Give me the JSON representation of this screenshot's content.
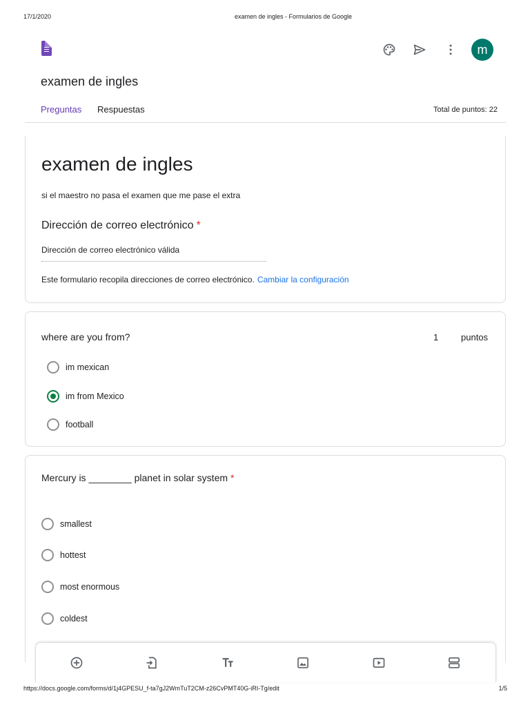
{
  "print": {
    "date": "17/1/2020",
    "title": "examen de ingles - Formularios de Google",
    "url": "https://docs.google.com/forms/d/1j4GPESU_f-ta7gJ2WmTuT2CM-z26CvPMT40G-iRI-Tg/edit",
    "page": "1/5"
  },
  "header": {
    "form_name": "examen de ingles",
    "avatar_letter": "m",
    "icons": [
      "forms-logo-icon",
      "palette-icon",
      "send-icon",
      "more-vert-icon"
    ],
    "colors": {
      "accent": "#673ab7",
      "avatar": "#00796b",
      "link": "#1a73e8",
      "required": "#d93025",
      "radio_checked": "#0b8043"
    }
  },
  "tabs": {
    "questions": "Preguntas",
    "responses": "Respuestas",
    "total_points": "Total de puntos: 22"
  },
  "form_header": {
    "title": "examen de ingles",
    "description": "si el maestro no pasa el examen que me pase el extra",
    "email_label": "Dirección de correo electrónico",
    "required_mark": "*",
    "email_hint": "Dirección de correo electrónico válida",
    "email_note": "Este formulario recopila direcciones de correo electrónico.",
    "change_settings": "Cambiar la configuración"
  },
  "questions": [
    {
      "title": "where are you from?",
      "points": "1",
      "points_label": "puntos",
      "options": [
        "im mexican",
        "im from Mexico",
        "football"
      ],
      "selected": 1
    },
    {
      "title": "Mercury is ________ planet in solar system",
      "required_mark": "*",
      "options": [
        "smallest",
        "hottest",
        "most enormous",
        "coldest"
      ]
    }
  ],
  "toolbar": {
    "icons": [
      "add-question-icon",
      "import-questions-icon",
      "add-title-icon",
      "add-image-icon",
      "add-video-icon",
      "add-section-icon"
    ]
  }
}
